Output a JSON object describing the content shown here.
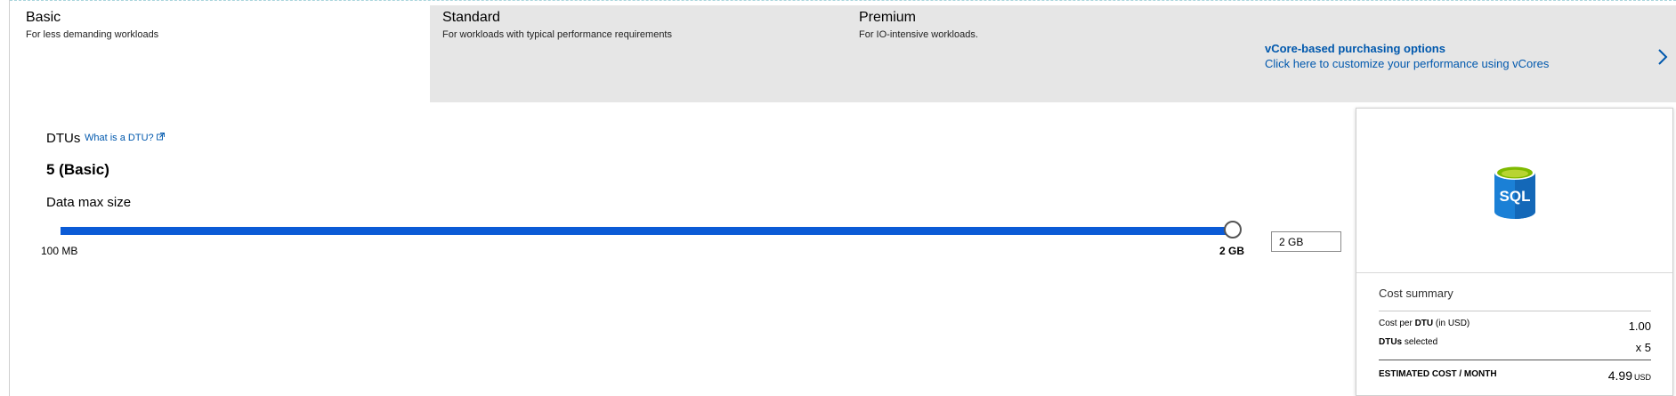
{
  "tiers": [
    {
      "name": "Basic",
      "description": "For less demanding workloads",
      "selected": true
    },
    {
      "name": "Standard",
      "description": "For workloads with typical performance requirements",
      "selected": false
    },
    {
      "name": "Premium",
      "description": "For IO-intensive workloads.",
      "selected": false
    }
  ],
  "vcore": {
    "title": "vCore-based purchasing options",
    "subtitle": "Click here to customize your performance using vCores"
  },
  "dtu": {
    "label": "DTUs",
    "help_link": "What is a DTU?",
    "value": "5 (Basic)"
  },
  "data_max_size": {
    "label": "Data max size",
    "min_label": "100 MB",
    "max_label": "2 GB",
    "input_value": "2 GB",
    "slider_fraction": 1.0
  },
  "summary": {
    "icon_text": "SQL",
    "title": "Cost summary",
    "cost_per_dtu_prefix": "Cost per",
    "cost_per_dtu_bold": "DTU",
    "cost_per_dtu_suffix": "(in USD)",
    "cost_per_dtu_value": "1.00",
    "dtus_selected_bold": "DTUs",
    "dtus_selected_suffix": "selected",
    "dtus_selected_value": "x 5",
    "estimated_label": "ESTIMATED COST / MONTH",
    "estimated_value": "4.99",
    "estimated_unit": "USD"
  },
  "colors": {
    "accent": "#0b5bd6",
    "link": "#0058ad",
    "tier_bar_bg": "#e6e6e6"
  },
  "icons": [
    "external-link-icon",
    "chevron-right-icon",
    "sql-database-icon"
  ]
}
